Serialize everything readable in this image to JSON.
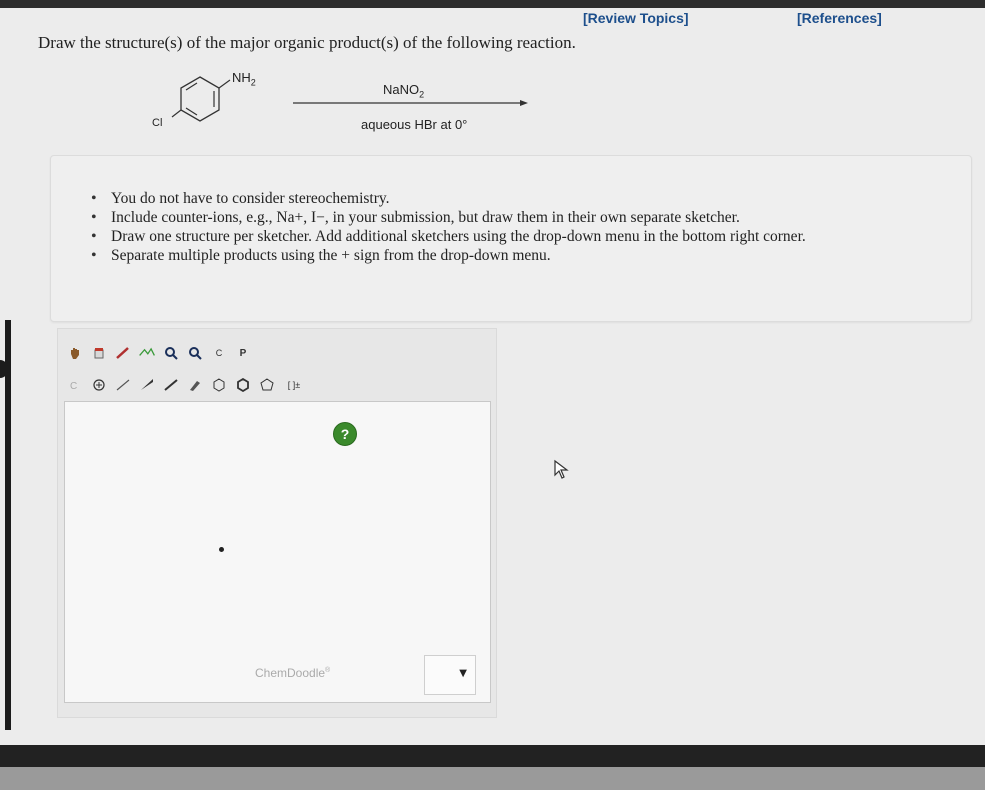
{
  "header": {
    "review_topics": "[Review Topics]",
    "references": "[References]"
  },
  "question": {
    "prompt": "Draw the structure(s) of the major organic product(s) of the following reaction."
  },
  "reaction": {
    "reactant_substituent_top": "NH2",
    "reactant_substituent_left": "Cl",
    "reagent_above": "NaNO2",
    "reagent_below": "aqueous HBr at 0°"
  },
  "instructions": {
    "items": [
      "You do not have to consider stereochemistry.",
      "Include counter-ions, e.g., Na+, I−, in your submission, but draw them in their own separate sketcher.",
      "Draw one structure per sketcher. Add additional sketchers using the drop-down menu in the bottom right corner.",
      "Separate multiple products using the + sign from the drop-down menu."
    ]
  },
  "sketcher": {
    "help_label": "?",
    "brand": "ChemDoodle",
    "brand_mark": "®",
    "toolbar_top": [
      "hand-icon",
      "eraser-icon",
      "pencil-icon",
      "lasso-icon",
      "zoom-in-icon",
      "zoom-out-icon",
      "copy-icon",
      "paste-icon"
    ],
    "copy_label": "C",
    "paste_label": "P",
    "toolbar_bottom": [
      "carbon-atom-icon",
      "charge-icon",
      "single-bond-icon",
      "wedge-bond-icon",
      "dash-bond-icon",
      "chain-icon",
      "benzene-ring-icon",
      "hexagon-ring-icon",
      "pentagon-ring-icon",
      "bracket-icon"
    ],
    "bracket_label": "[ ]±"
  },
  "dropdown": {
    "arrow": "▼"
  },
  "colors": {
    "link": "#1d4f8c",
    "help_green": "#3b8a2c",
    "page_bg": "#ececec"
  }
}
